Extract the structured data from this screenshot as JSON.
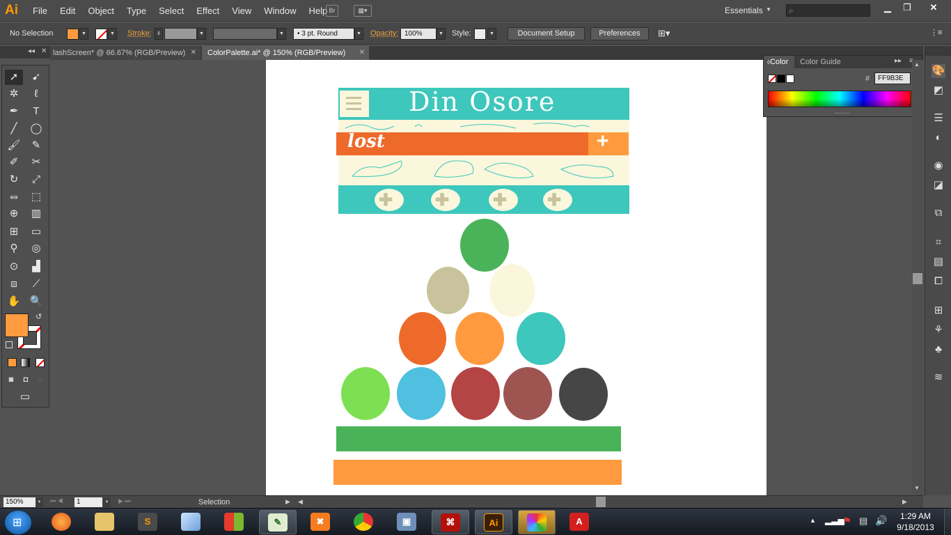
{
  "app": {
    "logo": "Ai",
    "menus": [
      "File",
      "Edit",
      "Object",
      "Type",
      "Select",
      "Effect",
      "View",
      "Window",
      "Help"
    ],
    "bridge_button": "Br",
    "workspace": "Essentials",
    "search_placeholder": ""
  },
  "controlbar": {
    "selection_label": "No Selection",
    "fill_color": "#FF9B3E",
    "stroke_label": "Stroke:",
    "brush_label": "3 pt. Round",
    "opacity_label": "Opacity:",
    "opacity_value": "100%",
    "style_label": "Style:",
    "document_setup": "Document Setup",
    "preferences": "Preferences"
  },
  "tabs": [
    {
      "label": "lashScreen* @ 66.67% (RGB/Preview)",
      "active": false
    },
    {
      "label": "ColorPalette.ai* @ 150% (RGB/Preview)",
      "active": true
    }
  ],
  "color_panel": {
    "tabs": [
      "Color",
      "Color Guide"
    ],
    "hash": "#",
    "hex_value": "FF9B3E"
  },
  "artwork": {
    "title_text": "Din Osore",
    "menu_text": "lost",
    "plus_text": "+",
    "colors": {
      "teal": "#3EC7BC",
      "cream": "#FAF7DC",
      "orange_dark": "#EE6A2A",
      "orange": "#FF9B3E",
      "green": "#4AB35A",
      "khaki": "#C8C39C",
      "light_green": "#7DE052",
      "sky": "#4FC0DF",
      "red": "#B54444",
      "rose": "#9E5552",
      "charcoal": "#464646"
    },
    "palette_rows": [
      [
        "green"
      ],
      [
        "khaki",
        "cream"
      ],
      [
        "orange_dark",
        "orange",
        "teal"
      ],
      [
        "light_green",
        "sky",
        "red",
        "rose",
        "charcoal"
      ]
    ]
  },
  "statusbar": {
    "zoom": "150%",
    "artboard_num": "1",
    "status_text": "Selection"
  },
  "taskbar": {
    "time": "1:29 AM",
    "date": "9/18/2013",
    "apps": [
      "start",
      "firefox",
      "explorer",
      "sublime",
      "cube",
      "office",
      "notepad",
      "xampp",
      "chrome",
      "virtualbox",
      "acrobat",
      "illustrator",
      "palette",
      "adobe-cc"
    ]
  }
}
